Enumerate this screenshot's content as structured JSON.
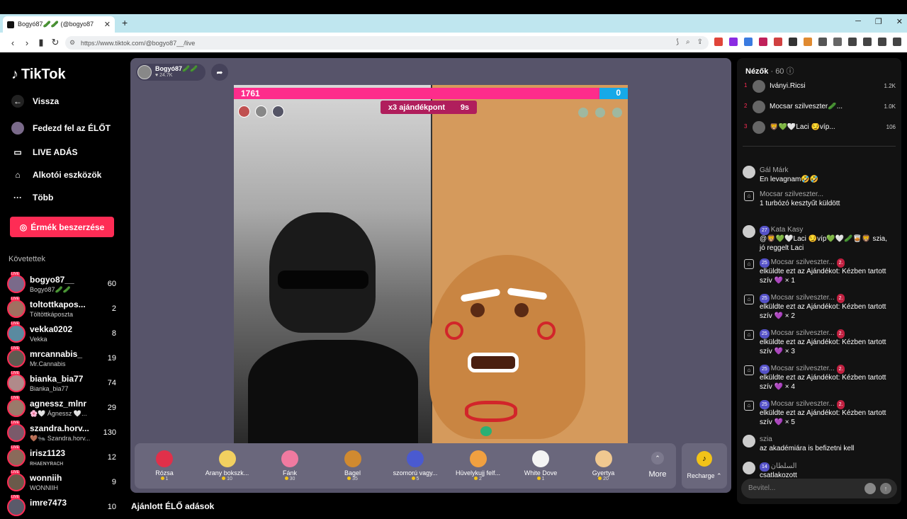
{
  "browser": {
    "tab_title": "Bogyó87🥒🥒 (@bogyo87",
    "url": "https://www.tiktok.com/@bogyo87__/live"
  },
  "sidebar": {
    "logo": "TikTok",
    "nav": [
      "Vissza",
      "Fedezd fel az ÉLŐT",
      "LIVE ADÁS",
      "Alkotói eszközök",
      "Több"
    ],
    "coins_button": "Érmék beszerzése",
    "following_heading": "Követettek",
    "following": [
      {
        "name": "bogyo87__",
        "sub": "Bogyó87🥒🥒",
        "count": "60",
        "color": "#7a6a8a"
      },
      {
        "name": "toltottkapos...",
        "sub": "Töltöttkáposzta",
        "count": "2",
        "color": "#a07060"
      },
      {
        "name": "vekka0202",
        "sub": "Vekka",
        "count": "8",
        "color": "#5a8aa0"
      },
      {
        "name": "mrcannabis_",
        "sub": "Mr.Cannabis",
        "count": "19",
        "color": "#605a50"
      },
      {
        "name": "bianka_bia77",
        "sub": "Bianka_bia77",
        "count": "74",
        "color": "#b08a8a"
      },
      {
        "name": "agnessz_mlnr",
        "sub": "🌸🤍 Ágnessz 🤍...",
        "count": "29",
        "color": "#9a7a6a"
      },
      {
        "name": "szandra.horv...",
        "sub": "🤎🐜 Szandra.horv...",
        "count": "130",
        "color": "#7a5a6a"
      },
      {
        "name": "irisz1123",
        "sub": "ʀʜᴀᴇɴʏʀᴀᴄʜ",
        "count": "12",
        "color": "#8a6a5a"
      },
      {
        "name": "wonniih",
        "sub": "WONNIIH",
        "count": "9",
        "color": "#6a5a4a"
      },
      {
        "name": "imre7473",
        "sub": "",
        "count": "10",
        "color": "#5a5a6a"
      }
    ]
  },
  "stream": {
    "host_name": "Bogyó87🥒🥒",
    "host_likes": "24.7K",
    "score_left": "1761",
    "score_right": "0",
    "multiplier_label": "x3 ajándékpont",
    "timer": "9s"
  },
  "gifts": [
    {
      "name": "Rózsa",
      "price": "1",
      "color": "#e0304a"
    },
    {
      "name": "Arany bokszk...",
      "price": "10",
      "color": "#f2d060"
    },
    {
      "name": "Fánk",
      "price": "30",
      "color": "#f07aa0"
    },
    {
      "name": "Bagel",
      "price": "35",
      "color": "#d08a30"
    },
    {
      "name": "szomorú vagy...",
      "price": "5",
      "color": "#4a5ad0"
    },
    {
      "name": "Hüvelykujj felf...",
      "price": "2",
      "color": "#f0a040"
    },
    {
      "name": "White Dove",
      "price": "1",
      "color": "#f4f4f4"
    },
    {
      "name": "Gyertya",
      "price": "20",
      "color": "#f0c890"
    }
  ],
  "gift_more": "More",
  "recharge": "Recharge",
  "recommended_heading": "Ajánlott ÉLŐ adások",
  "viewers": {
    "title": "Nézők",
    "count": "· 60",
    "list": [
      {
        "rank": "1",
        "name": "Iványi.Ricsi",
        "value": "1.2K"
      },
      {
        "rank": "2",
        "name": "Mocsar szilveszter🥒...",
        "value": "1.0K"
      },
      {
        "rank": "3",
        "name": "🦁💚🤍Laci 😏víp...",
        "value": "106"
      }
    ]
  },
  "chat": [
    {
      "name": "Gál Márk",
      "text": "En levagnam🤣🤣"
    },
    {
      "name": "Mocsar szilveszter...",
      "text": "1 turbózó kesztyűt küldött"
    },
    {
      "name": "Kata Kasy",
      "text": "@🦁💚🤍Laci 😏víp💚🤍🥒🥃🦁 szia, jó reggelt Laci",
      "level": "27"
    },
    {
      "name": "Mocsar szilveszter...",
      "text": "elküldte ezt az Ajándékot: Kézben tartott szív 💜 × 1",
      "level": "25",
      "rank": "2."
    },
    {
      "name": "Mocsar szilveszter...",
      "text": "elküldte ezt az Ajándékot: Kézben tartott szív 💜 × 2",
      "level": "25",
      "rank": "2."
    },
    {
      "name": "Mocsar szilveszter...",
      "text": "elküldte ezt az Ajándékot: Kézben tartott szív 💜 × 3",
      "level": "25",
      "rank": "2."
    },
    {
      "name": "Mocsar szilveszter...",
      "text": "elküldte ezt az Ajándékot: Kézben tartott szív 💜 × 4",
      "level": "25",
      "rank": "2."
    },
    {
      "name": "Mocsar szilveszter...",
      "text": "elküldte ezt az Ajándékot: Kézben tartott szív 💜 × 5",
      "level": "25",
      "rank": "2."
    },
    {
      "name": "szia",
      "text": "az akadémiára is befizetni kell"
    },
    {
      "name": "السلطان",
      "text": "csatlakozott",
      "level": "14"
    }
  ],
  "input_placeholder": "Bevitel..."
}
